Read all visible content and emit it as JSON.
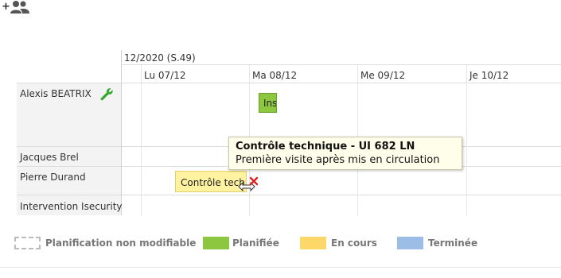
{
  "toolbar": {
    "add_people_label": "+"
  },
  "calendar": {
    "week_label": "12/2020 (S.49)",
    "days": [
      "Lu 07/12",
      "Ma 08/12",
      "Me 09/12",
      "Je 10/12"
    ],
    "rows": [
      {
        "name": "Alexis BEATRIX",
        "icon": "wrench-icon",
        "icon_color": "#3aa635"
      },
      {
        "name": "Jacques Brel"
      },
      {
        "name": "Pierre Durand"
      },
      {
        "name": "Intervention Isecurity"
      }
    ]
  },
  "events": {
    "alexis_event": {
      "label": "Ins",
      "color": "#8dc63f"
    },
    "pierre_event": {
      "label": "Contrôle techr",
      "color": "#fff2a0"
    }
  },
  "tooltip": {
    "title": "Contrôle technique - UI 682 LN",
    "subtitle": "Première visite après mis en circulation"
  },
  "legend": [
    {
      "label": "Planification non modifiable",
      "style": "dashed",
      "color": "#bbbbbb"
    },
    {
      "label": "Planifiée",
      "color": "#8dc63f"
    },
    {
      "label": "En cours",
      "color": "#fdd868"
    },
    {
      "label": "Terminée",
      "color": "#9cbde6"
    }
  ]
}
